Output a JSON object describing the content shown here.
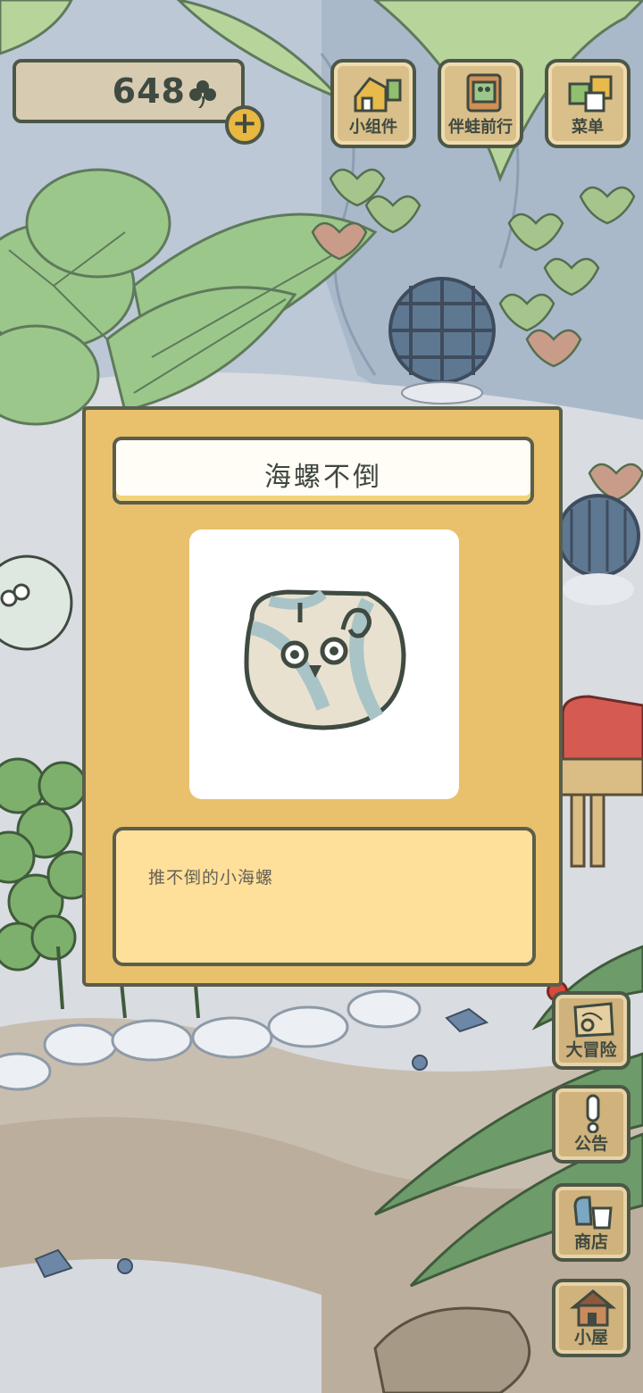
{
  "hud": {
    "clover_count": "648",
    "plus_symbol": "+"
  },
  "top_menu": [
    {
      "label": "小组件",
      "icon": "widget-icon"
    },
    {
      "label": "伴蛙前行",
      "icon": "frog-companion-icon"
    },
    {
      "label": "菜单",
      "icon": "menu-icon"
    }
  ],
  "side_menu": [
    {
      "label": "大冒险",
      "icon": "map-icon"
    },
    {
      "label": "公告",
      "icon": "exclamation-icon"
    },
    {
      "label": "商店",
      "icon": "shop-bag-icon"
    },
    {
      "label": "小屋",
      "icon": "house-icon"
    }
  ],
  "item_dialog": {
    "title": "海螺不倒",
    "description": "推不倒的小海螺",
    "image": "snail-shell-roly-poly-icon"
  },
  "colors": {
    "dialog_bg": "#e9c06c",
    "desc_bg": "#ffe09a",
    "outline": "#5a5e4b",
    "button_wood": "#d9bf8a"
  }
}
